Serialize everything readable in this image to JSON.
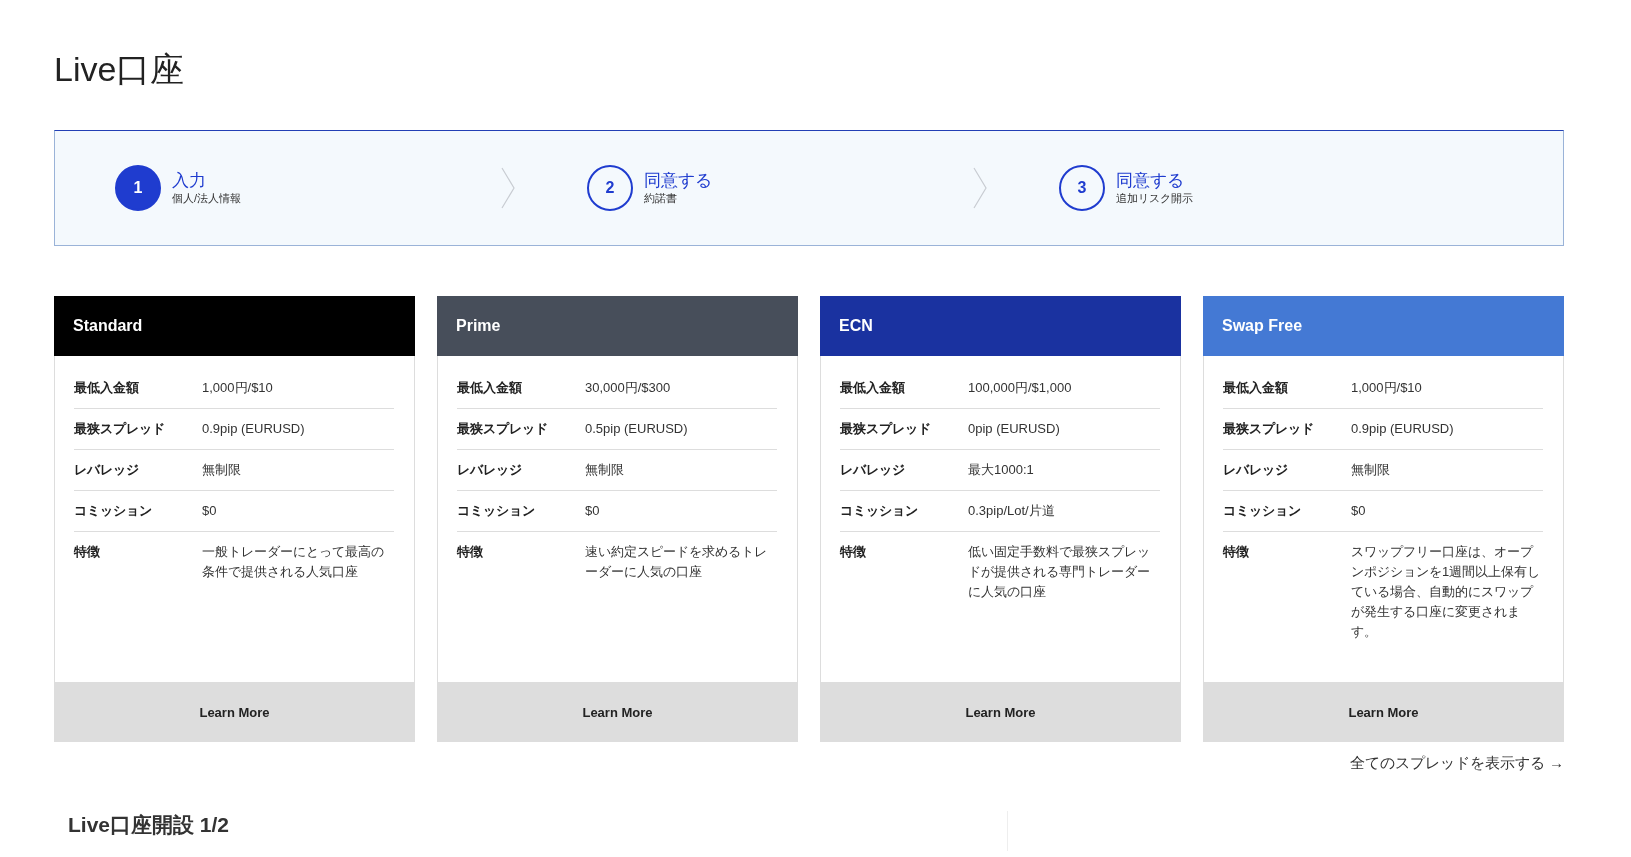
{
  "title": "Live口座",
  "steps": [
    {
      "number": "1",
      "label": "入力",
      "sublabel": "個人/法人情報",
      "selected": true
    },
    {
      "number": "2",
      "label": "同意する",
      "sublabel": "約諾書",
      "selected": false
    },
    {
      "number": "3",
      "label": "同意する",
      "sublabel": "追加リスク開示",
      "selected": false
    }
  ],
  "cards": [
    {
      "name": "Standard",
      "color": "#000000",
      "rows": [
        {
          "label": "最低入金額",
          "value": "1,000円/$10"
        },
        {
          "label": "最狭スプレッド",
          "value": "0.9pip (EURUSD)"
        },
        {
          "label": "レバレッジ",
          "value": "無制限"
        },
        {
          "label": "コミッション",
          "value": "$0"
        },
        {
          "label": "特徴",
          "value": "一般トレーダーにとって最高の条件で提供される人気口座"
        }
      ],
      "button": "Learn More"
    },
    {
      "name": "Prime",
      "color": "#474e5a",
      "rows": [
        {
          "label": "最低入金額",
          "value": "30,000円/$300"
        },
        {
          "label": "最狭スプレッド",
          "value": "0.5pip (EURUSD)"
        },
        {
          "label": "レバレッジ",
          "value": "無制限"
        },
        {
          "label": "コミッション",
          "value": "$0"
        },
        {
          "label": "特徴",
          "value": "速い約定スピードを求めるトレーダーに人気の口座"
        }
      ],
      "button": "Learn More"
    },
    {
      "name": "ECN",
      "color": "#1a32a0",
      "rows": [
        {
          "label": "最低入金額",
          "value": "100,000円/$1,000"
        },
        {
          "label": "最狭スプレッド",
          "value": "0pip (EURUSD)"
        },
        {
          "label": "レバレッジ",
          "value": "最大1000:1"
        },
        {
          "label": "コミッション",
          "value": "0.3pip/Lot/片道"
        },
        {
          "label": "特徴",
          "value": "低い固定手数料で最狭スプレッドが提供される専門トレーダーに人気の口座"
        }
      ],
      "button": "Learn More"
    },
    {
      "name": "Swap Free",
      "color": "#4479d4",
      "rows": [
        {
          "label": "最低入金額",
          "value": "1,000円/$10"
        },
        {
          "label": "最狭スプレッド",
          "value": "0.9pip (EURUSD)"
        },
        {
          "label": "レバレッジ",
          "value": "無制限"
        },
        {
          "label": "コミッション",
          "value": "$0"
        },
        {
          "label": "特徴",
          "value": "スワップフリー口座は、オープンポジションを1週間以上保有している場合、自動的にスワップが発生する口座に変更されます。"
        }
      ],
      "button": "Learn More"
    }
  ],
  "spreads_link": "全てのスプレッドを表示する →",
  "section_heading": "Live口座開設 1/2"
}
